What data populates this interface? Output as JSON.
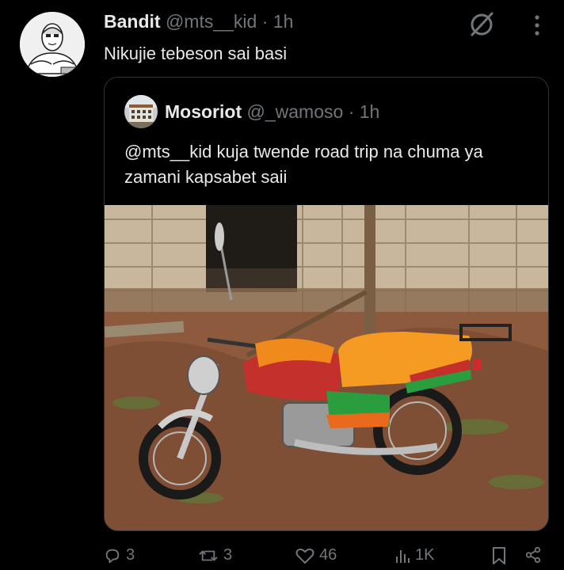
{
  "tweet": {
    "author_name": "Bandit",
    "author_handle": "@mts__kid",
    "separator": "·",
    "time": "1h",
    "text": "Nikujie tebeson sai basi"
  },
  "quoted_tweet": {
    "author_name": "Mosoriot",
    "author_handle": "@_wamoso",
    "separator": "·",
    "time": "1h",
    "text": "@mts__kid kuja twende road trip na chuma ya zamani kapsabet saii"
  },
  "actions": {
    "replies": "3",
    "reposts": "3",
    "likes": "46",
    "views": "1K"
  },
  "icons": {
    "grok": "grok-icon",
    "more": "more-dots-icon",
    "reply": "reply-icon",
    "repost": "repost-icon",
    "like": "heart-icon",
    "views": "views-icon",
    "bookmark": "bookmark-icon",
    "share": "share-icon"
  },
  "colors": {
    "background": "#000000",
    "text": "#e7e9ea",
    "muted": "#71767b",
    "border": "#2f3336"
  }
}
